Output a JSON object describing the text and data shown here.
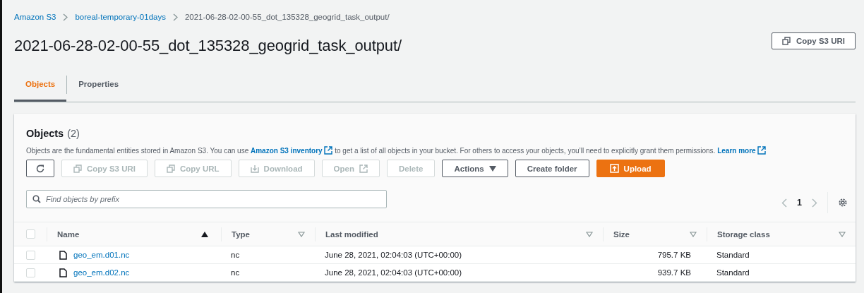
{
  "breadcrumbs": [
    {
      "label": "Amazon S3",
      "kind": "link"
    },
    {
      "label": "boreal-temporary-01days",
      "kind": "link"
    },
    {
      "label": "2021-06-28-02-00-55_dot_135328_geogrid_task_output/",
      "kind": "current"
    }
  ],
  "title": "2021-06-28-02-00-55_dot_135328_geogrid_task_output/",
  "header_button": {
    "label": "Copy S3 URI"
  },
  "tabs": [
    {
      "label": "Objects",
      "selected": true
    },
    {
      "label": "Properties",
      "selected": false
    }
  ],
  "panel": {
    "title": "Objects",
    "count": "(2)",
    "description": [
      {
        "kind": "text",
        "text": "Objects are the fundamental entities stored in Amazon S3. You can use"
      },
      {
        "kind": "link",
        "text": "Amazon S3 inventory"
      },
      {
        "kind": "text",
        "text": "to get a list of all objects in your bucket. For others to access your objects, you’ll need to explicitly grant them permissions."
      },
      {
        "kind": "link",
        "text": "Learn more"
      }
    ],
    "toolbar": [
      {
        "kind": "refresh",
        "disabled": false
      },
      {
        "kind": "copy",
        "label": "Copy S3 URI",
        "disabled": true
      },
      {
        "kind": "copy",
        "label": "Copy URL",
        "disabled": true
      },
      {
        "kind": "download",
        "label": "Download",
        "disabled": true
      },
      {
        "kind": "open",
        "label": "Open",
        "disabled": true
      },
      {
        "kind": "plain",
        "label": "Delete",
        "disabled": true
      },
      {
        "kind": "dropdown",
        "label": "Actions",
        "disabled": false
      },
      {
        "kind": "plain",
        "label": "Create folder",
        "disabled": false
      },
      {
        "kind": "primary",
        "label": "Upload",
        "disabled": false
      }
    ],
    "search": {
      "placeholder": "Find objects by prefix"
    },
    "pagination": {
      "page": "1"
    },
    "table": {
      "select_all_checked": false,
      "columns": [
        {
          "label": "Name",
          "sorted": true
        },
        {
          "label": "Type",
          "sorted": false
        },
        {
          "label": "Last modified",
          "sorted": false
        },
        {
          "label": "Size",
          "sorted": false
        },
        {
          "label": "Storage class",
          "sorted": false
        }
      ],
      "rows": [
        {
          "checked": false,
          "name": "geo_em.d01.nc",
          "type": "nc",
          "last_modified": "June 28, 2021, 02:04:03 (UTC+00:00)",
          "size": "795.7 KB",
          "storage_class": "Standard"
        },
        {
          "checked": false,
          "name": "geo_em.d02.nc",
          "type": "nc",
          "last_modified": "June 28, 2021, 02:04:03 (UTC+00:00)",
          "size": "939.7 KB",
          "storage_class": "Standard"
        }
      ]
    }
  }
}
